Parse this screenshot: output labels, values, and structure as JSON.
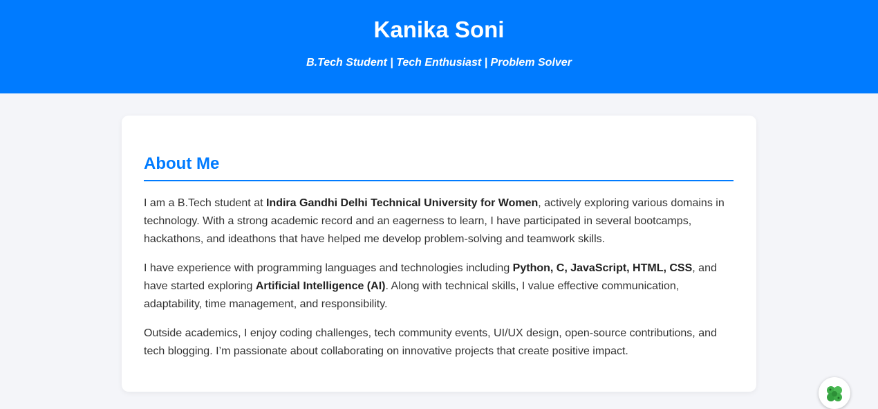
{
  "header": {
    "name": "Kanika Soni",
    "tagline": "B.Tech Student | Tech Enthusiast | Problem Solver",
    "background_color": "#007bff"
  },
  "about": {
    "title": "About Me",
    "accent_color": "#007bff",
    "p1": {
      "t1": "I am a B.Tech student at ",
      "b1": "Indira Gandhi Delhi Technical University for Women",
      "t2": ", actively exploring various domains in technology. With a strong academic record and an eagerness to learn, I have participated in several bootcamps, hackathons, and ideathons that have helped me develop problem-solving and teamwork skills."
    },
    "p2": {
      "t1": "I have experience with programming languages and technologies including ",
      "b1": "Python, C, JavaScript, HTML, CSS",
      "t2": ", and have started exploring ",
      "b2": "Artificial Intelligence (AI)",
      "t3": ". Along with technical skills, I value effective communication, adaptability, time management, and responsibility."
    },
    "p3": {
      "t1": "Outside academics, I enjoy coding challenges, tech community events, UI/UX design, open-source contributions, and tech blogging. I’m passionate about collaborating on innovative projects that create positive impact."
    }
  },
  "floating_button": {
    "icon": "clover-icon"
  }
}
